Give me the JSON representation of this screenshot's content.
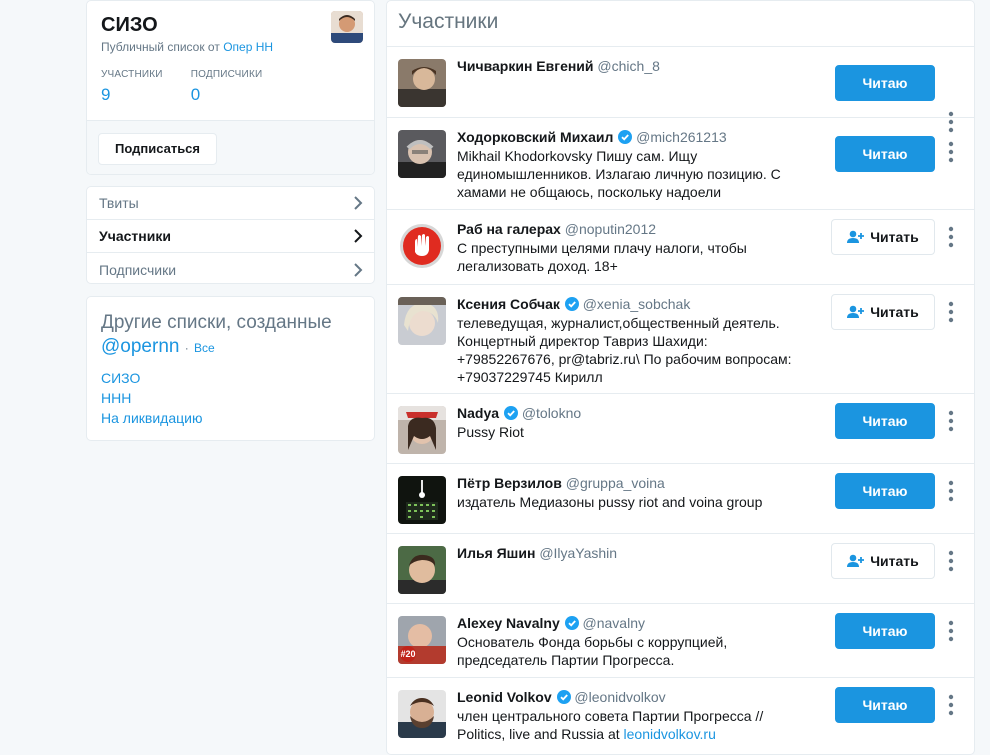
{
  "list": {
    "title": "СИЗО",
    "owner_prefix": "Публичный список от",
    "owner_name": "Опер НН",
    "members_label": "УЧАСТНИКИ",
    "members_count": "9",
    "subscribers_label": "ПОДПИСЧИКИ",
    "subscribers_count": "0",
    "subscribe_button": "Подписаться"
  },
  "nav": [
    {
      "label": "Твиты"
    },
    {
      "label": "Участники"
    },
    {
      "label": "Подписчики"
    }
  ],
  "other_lists": {
    "title": "Другие списки, созданные",
    "handle": "@opernn",
    "separator": "·",
    "all_link": "Все",
    "items": [
      "СИЗО",
      "ННН",
      "На ликвидацию"
    ]
  },
  "members_title": "Участники",
  "members": [
    {
      "name": "Чичваркин Евгений",
      "handle": "@chich_8",
      "verified": false,
      "bio": "",
      "button": "Читаю",
      "following": true
    },
    {
      "name": "Ходорковский Михаил",
      "handle": "@mich261213",
      "verified": true,
      "bio": "Mikhail Khodorkovsky Пишу сам. Ищу единомышленников. Излагаю личную позицию. С хамами не общаюсь, поскольку надоели",
      "button": "Читаю",
      "following": true
    },
    {
      "name": "Раб на галерах",
      "handle": "@noputin2012",
      "verified": false,
      "bio": "С преступными целями плачу налоги, чтобы легализовать доход. 18+",
      "button": "Читать",
      "following": false
    },
    {
      "name": "Ксения Собчак",
      "handle": "@xenia_sobchak",
      "verified": true,
      "bio": "телеведущая, журналист,общественный деятель. Концертный директор Тавриз Шахиди: +79852267676, pr@tabriz.ru\\ По рабочим вопросам: +79037229745 Кирилл",
      "button": "Читать",
      "following": false
    },
    {
      "name": "Nadya",
      "handle": "@tolokno",
      "verified": true,
      "bio": "Pussy Riot",
      "button": "Читаю",
      "following": true
    },
    {
      "name": "Пётр Верзилов",
      "handle": "@gruppa_voina",
      "verified": false,
      "bio": "издатель Медиазоны pussy riot and voina group",
      "button": "Читаю",
      "following": true
    },
    {
      "name": "Илья Яшин",
      "handle": "@IlyaYashin",
      "verified": false,
      "bio": "",
      "button": "Читать",
      "following": false
    },
    {
      "name": "Alexey Navalny",
      "handle": "@navalny",
      "verified": true,
      "bio": "Основатель Фонда борьбы с коррупцией, председатель Партии Прогресса.",
      "button": "Читаю",
      "following": true
    },
    {
      "name": "Leonid Volkov",
      "handle": "@leonidvolkov",
      "verified": true,
      "bio": "член центрального совета Партии Прогресса // Politics, live and Russia at",
      "bio_link": "leonidvolkov.ru",
      "button": "Читаю",
      "following": true
    }
  ],
  "colors": {
    "accent": "#1b95e0",
    "verified": "#1da1f2"
  }
}
